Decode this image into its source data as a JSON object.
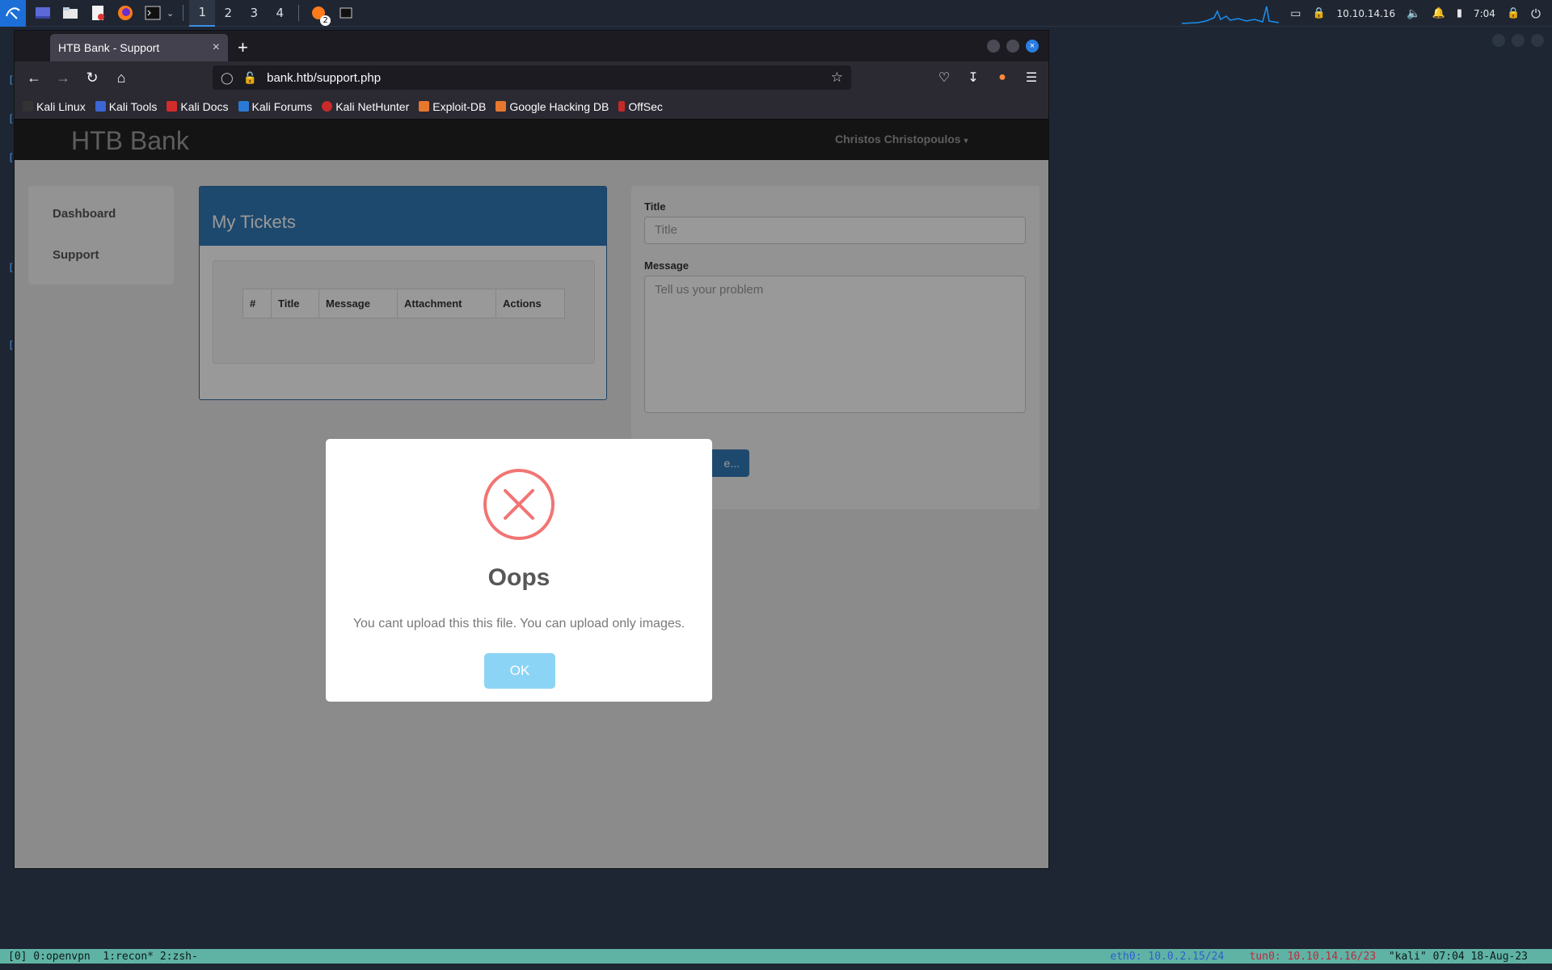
{
  "taskbar": {
    "workspaces": [
      "1",
      "2",
      "3",
      "4"
    ],
    "badge_count": "2",
    "ip": "10.10.14.16",
    "time": "7:04"
  },
  "browser": {
    "tab_title": "HTB Bank - Support",
    "url": "bank.htb/support.php",
    "bookmarks": [
      "Kali Linux",
      "Kali Tools",
      "Kali Docs",
      "Kali Forums",
      "Kali NetHunter",
      "Exploit-DB",
      "Google Hacking DB",
      "OffSec"
    ]
  },
  "site": {
    "brand": "HTB Bank",
    "user": "Christos Christopoulos",
    "sidebar": [
      "Dashboard",
      "Support"
    ],
    "tickets_title": "My Tickets",
    "table_headers": [
      "#",
      "Title",
      "Message",
      "Attachment",
      "Actions"
    ],
    "form": {
      "title_label": "Title",
      "title_placeholder": "Title",
      "message_label": "Message",
      "message_placeholder": "Tell us your problem",
      "choose_label": "e..."
    }
  },
  "modal": {
    "title": "Oops",
    "text": "You cant upload this this file. You can upload only images.",
    "ok": "OK"
  },
  "tmux": {
    "left": "[0] 0:openvpn  1:recon* 2:zsh-",
    "eth_label": "eth0:",
    "eth_value": "10.0.2.15/24",
    "tun_label": "tun0:",
    "tun_value": "10.10.14.16/23",
    "host": "\"kali\" 07:04 18-Aug-23"
  },
  "colors": {
    "accent": "#337ab7",
    "error": "#f27474",
    "ok_button": "#8cd4f5"
  }
}
